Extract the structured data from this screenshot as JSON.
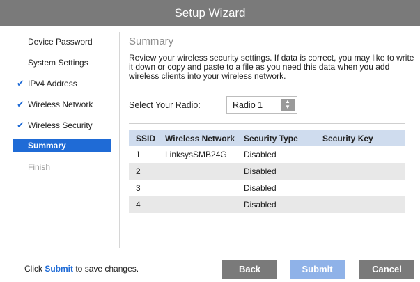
{
  "window": {
    "title": "Setup Wizard"
  },
  "sidebar": {
    "items": [
      {
        "label": "Device Password",
        "checked": false,
        "state": "normal"
      },
      {
        "label": "System Settings",
        "checked": false,
        "state": "normal"
      },
      {
        "label": "IPv4 Address",
        "checked": true,
        "state": "normal"
      },
      {
        "label": "Wireless Network",
        "checked": true,
        "state": "normal"
      },
      {
        "label": "Wireless Security",
        "checked": true,
        "state": "normal"
      },
      {
        "label": "Summary",
        "checked": false,
        "state": "active"
      },
      {
        "label": "Finish",
        "checked": false,
        "state": "disabled"
      }
    ]
  },
  "main": {
    "heading": "Summary",
    "description": "Review your wireless security settings. If data is correct, you may like to write it down or copy and paste to a file as you need this data when you add wireless clients into your wireless network.",
    "radio": {
      "label": "Select Your Radio:",
      "value": "Radio 1"
    },
    "table": {
      "headers": [
        "SSID",
        "Wireless Network",
        "Security Type",
        "Security Key"
      ],
      "rows": [
        [
          "1",
          "LinksysSMB24G",
          "Disabled",
          ""
        ],
        [
          "2",
          "",
          "Disabled",
          ""
        ],
        [
          "3",
          "",
          "Disabled",
          ""
        ],
        [
          "4",
          "",
          "Disabled",
          ""
        ]
      ]
    }
  },
  "footer": {
    "text_prefix": "Click ",
    "text_link": "Submit",
    "text_suffix": " to save changes.",
    "back_label": "Back",
    "submit_label": "Submit",
    "cancel_label": "Cancel"
  },
  "colors": {
    "accent": "#1f6bd6",
    "titlebar": "#7a7a7a",
    "table_header": "#cfdcee"
  }
}
